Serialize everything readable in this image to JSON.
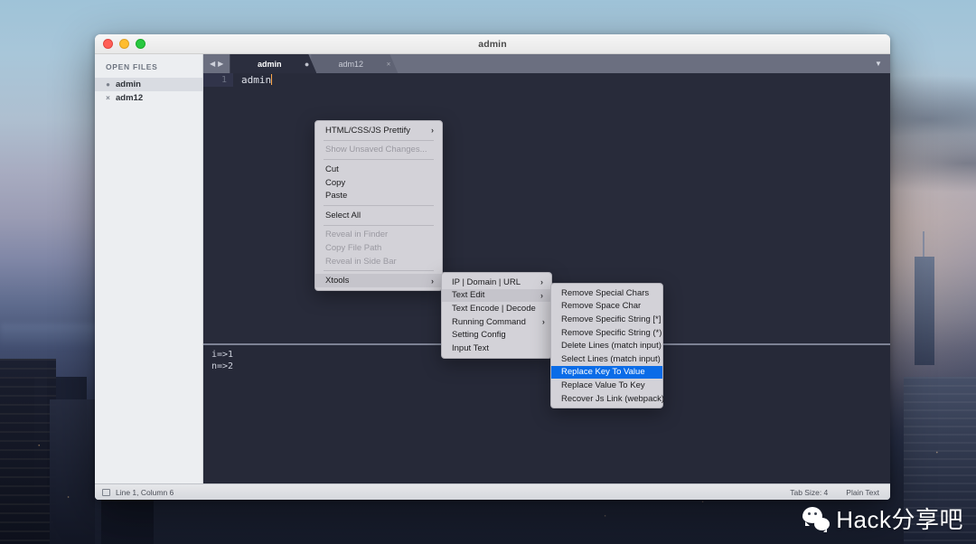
{
  "window": {
    "title": "admin",
    "traffic_lights": [
      "close",
      "minimize",
      "zoom"
    ]
  },
  "sidebar": {
    "title": "OPEN FILES",
    "files": [
      {
        "name": "admin",
        "mark": "●",
        "active": true
      },
      {
        "name": "adm12",
        "mark": "×",
        "active": false
      }
    ]
  },
  "tabbar": {
    "nav_prev": "◀",
    "nav_next": "▶",
    "chevron": "▼",
    "tabs": [
      {
        "label": "admin",
        "close": "●",
        "active": true
      },
      {
        "label": "adm12",
        "close": "×",
        "active": false
      }
    ]
  },
  "editor": {
    "lines": [
      {
        "number": "1",
        "text": "admin"
      }
    ]
  },
  "console": {
    "lines": [
      "i=>1",
      "n=>2"
    ]
  },
  "statusbar": {
    "left": "Line 1, Column 6",
    "tab_size": "Tab Size: 4",
    "syntax": "Plain Text"
  },
  "context_menu": {
    "items": [
      {
        "label": "HTML/CSS/JS Prettify",
        "arrow": "›",
        "state": "normal"
      },
      {
        "type": "separator"
      },
      {
        "label": "Show Unsaved Changes...",
        "state": "disabled"
      },
      {
        "type": "separator"
      },
      {
        "label": "Cut",
        "state": "normal"
      },
      {
        "label": "Copy",
        "state": "normal"
      },
      {
        "label": "Paste",
        "state": "normal"
      },
      {
        "type": "separator"
      },
      {
        "label": "Select All",
        "state": "normal"
      },
      {
        "type": "separator"
      },
      {
        "label": "Reveal in Finder",
        "state": "disabled"
      },
      {
        "label": "Copy File Path",
        "state": "disabled"
      },
      {
        "label": "Reveal in Side Bar",
        "state": "disabled"
      },
      {
        "type": "separator"
      },
      {
        "label": "Xtools",
        "arrow": "›",
        "state": "hover"
      }
    ]
  },
  "xtools_menu": {
    "items": [
      {
        "label": "IP | Domain | URL",
        "arrow": "›",
        "state": "normal"
      },
      {
        "label": "Text Edit",
        "arrow": "›",
        "state": "hover"
      },
      {
        "label": "Text Encode | Decode",
        "arrow": "›",
        "state": "normal"
      },
      {
        "label": "Running Command",
        "arrow": "›",
        "state": "normal"
      },
      {
        "label": "Setting Config",
        "state": "normal"
      },
      {
        "label": "Input Text",
        "state": "normal"
      }
    ]
  },
  "textedit_menu": {
    "items": [
      {
        "label": "Remove Special Chars",
        "state": "normal"
      },
      {
        "label": "Remove Space Char",
        "state": "normal"
      },
      {
        "label": "Remove Specific String [*]",
        "state": "normal"
      },
      {
        "label": "Remove Specific String (*)",
        "state": "normal"
      },
      {
        "label": "Delete Lines (match input)",
        "state": "normal"
      },
      {
        "label": "Select Lines (match input)",
        "state": "normal"
      },
      {
        "label": "Replace Key To Value",
        "state": "selected"
      },
      {
        "label": "Replace Value To Key",
        "state": "normal"
      },
      {
        "label": "Recover Js Link (webpack)",
        "state": "normal"
      }
    ]
  },
  "watermark": {
    "text": "Hack分享吧"
  },
  "colors": {
    "selection_blue": "#0a6ce8",
    "menu_bg": "#d3d2d8",
    "editor_bg": "#282b3a",
    "caret": "#ffa94d"
  }
}
